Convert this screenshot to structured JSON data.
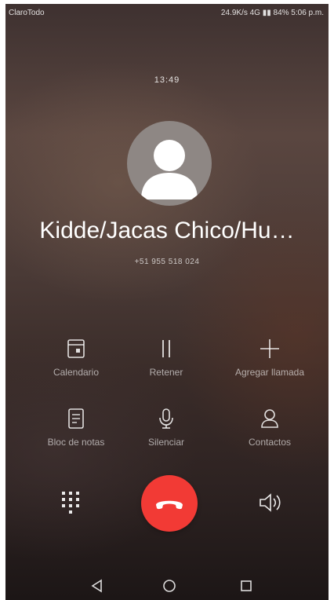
{
  "status_bar": {
    "carrier": "ClaroTodo",
    "right_text": "24.9K/s  4G  ▮▮  84%  5:06 p.m."
  },
  "call": {
    "duration": "13:49",
    "contact_name": "Kidde/Jacas Chico/Hu…",
    "phone_number": "+51 955 518 024"
  },
  "actions": [
    {
      "label": "Calendario",
      "icon": "calendar-icon"
    },
    {
      "label": "Retener",
      "icon": "pause-icon"
    },
    {
      "label": "Agregar llamada",
      "icon": "plus-icon"
    },
    {
      "label": "Bloc de notas",
      "icon": "notes-icon"
    },
    {
      "label": "Silenciar",
      "icon": "microphone-icon"
    },
    {
      "label": "Contactos",
      "icon": "contacts-icon"
    }
  ],
  "controls": {
    "dialpad_icon": "dialpad-icon",
    "end_call_icon": "end-call-icon",
    "speaker_icon": "speaker-icon",
    "end_call_color": "#f23a35"
  },
  "nav": {
    "back_icon": "back-icon",
    "home_icon": "home-icon",
    "recent_icon": "recent-apps-icon"
  }
}
